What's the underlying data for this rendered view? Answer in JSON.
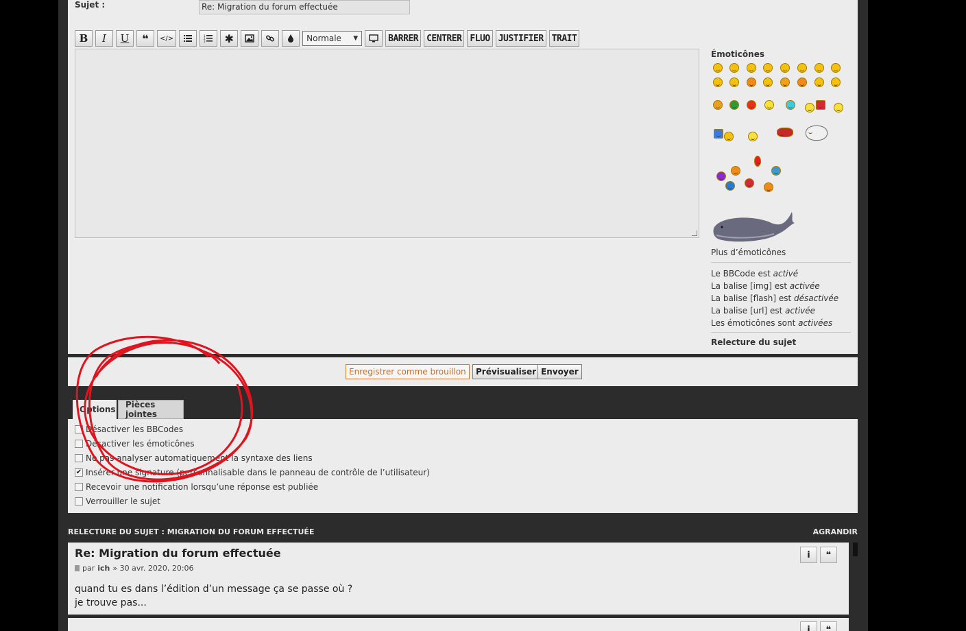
{
  "subject": {
    "label": "Sujet :",
    "value": "Re: Migration du forum effectuée"
  },
  "toolbar": {
    "bold": "B",
    "italic": "I",
    "underline": "U",
    "font_size": "Normale",
    "barrer": "BARRER",
    "centrer": "CENTRER",
    "fluo": "FLUO",
    "justifier": "JUSTIFIER",
    "trait": "TRAIT"
  },
  "sidebar": {
    "emoticons_title": "Émoticônes",
    "more_emoticons": "Plus d’émoticônes",
    "status": [
      {
        "prefix": "Le BBCode est ",
        "state": "activé"
      },
      {
        "prefix": "La balise [img] est ",
        "state": "activée"
      },
      {
        "prefix": "La balise [flash] est ",
        "state": "désactivée"
      },
      {
        "prefix": "La balise [url] est ",
        "state": "activée"
      },
      {
        "prefix": "Les émoticônes sont ",
        "state": "activées"
      }
    ],
    "review_link": "Relecture du sujet"
  },
  "submit": {
    "draft": "Enregistrer comme brouillon",
    "preview": "Prévisualiser",
    "send": "Envoyer"
  },
  "tabs": {
    "options": "Options",
    "attachments": "Pièces jointes"
  },
  "options": [
    {
      "label": "Désactiver les BBCodes",
      "checked": false
    },
    {
      "label": "Désactiver les émoticônes",
      "checked": false
    },
    {
      "label": "Ne pas analyser automatiquement la syntaxe des liens",
      "checked": false
    },
    {
      "label": "Insérer une signature (personnalisable dans le panneau de contrôle de l’utilisateur)",
      "checked": true
    },
    {
      "label": "Recevoir une notification lorsqu’une réponse est publiée",
      "checked": false
    },
    {
      "label": "Verrouiller le sujet",
      "checked": false
    }
  ],
  "review": {
    "header": "RELECTURE DU SUJET : MIGRATION DU FORUM EFFECTUÉE",
    "expand": "AGRANDIR",
    "post": {
      "title": "Re: Migration du forum effectuée",
      "by": "par",
      "author": "ich",
      "date": "» 30 avr. 2020, 20:06",
      "line1": "quand tu es dans l’édition d’un message ça se passe où ?",
      "line2": "je trouve pas..."
    }
  },
  "colors": {
    "annotation_circle": "#e0141e",
    "draft_accent": "#d06a1c"
  }
}
